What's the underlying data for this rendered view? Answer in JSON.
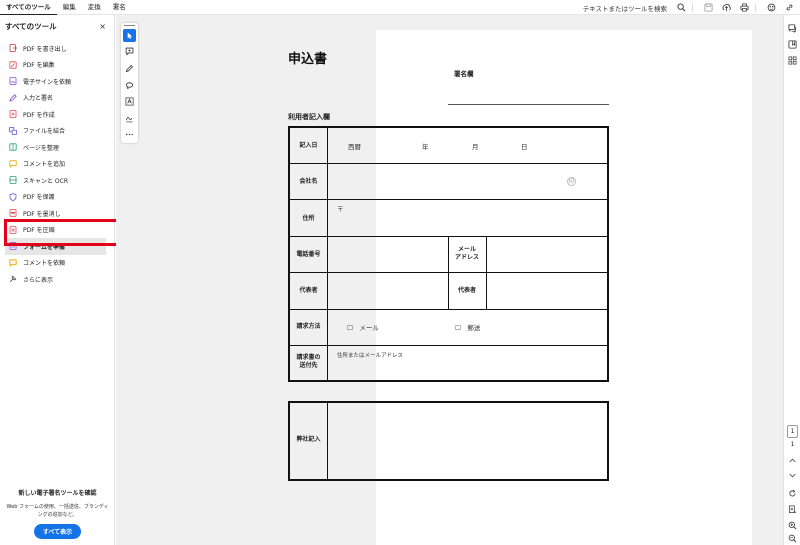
{
  "menu": {
    "items": [
      "すべてのツール",
      "編集",
      "変換",
      "署名"
    ]
  },
  "toolbar": {
    "search_text": "テキストまたはツールを検索",
    "icons": [
      "search-icon",
      "save-icon",
      "upload-icon",
      "print-icon",
      "share-icon",
      "link-icon"
    ]
  },
  "left_panel": {
    "title": "すべてのツール",
    "close": "×",
    "tools": [
      {
        "label": "PDF を書き出し",
        "icon": "export-pdf-icon",
        "color": "#d7373f"
      },
      {
        "label": "PDF を編集",
        "icon": "edit-pdf-icon",
        "color": "#e34850"
      },
      {
        "label": "電子サインを依頼",
        "icon": "request-esign-icon",
        "color": "#8d4bd6"
      },
      {
        "label": "入力と署名",
        "icon": "fill-sign-icon",
        "color": "#8d4bd6"
      },
      {
        "label": "PDF を作成",
        "icon": "create-pdf-icon",
        "color": "#e34850"
      },
      {
        "label": "ファイルを結合",
        "icon": "combine-files-icon",
        "color": "#5c5ce0"
      },
      {
        "label": "ページを整理",
        "icon": "organize-pages-icon",
        "color": "#2d9d78"
      },
      {
        "label": "コメントを追加",
        "icon": "comment-icon",
        "color": "#e6a700"
      },
      {
        "label": "スキャンと OCR",
        "icon": "scan-ocr-icon",
        "color": "#2d9d78"
      },
      {
        "label": "PDF を保護",
        "icon": "protect-pdf-icon",
        "color": "#5c5ce0"
      },
      {
        "label": "PDF を墨消し",
        "icon": "redact-pdf-icon",
        "color": "#e34850"
      },
      {
        "label": "PDF を圧縮",
        "icon": "compress-pdf-icon",
        "color": "#e34850"
      },
      {
        "label": "フォームを準備",
        "icon": "prepare-form-icon",
        "color": "#8d4bd6",
        "selected": true
      },
      {
        "label": "コメントを依頼",
        "icon": "request-comment-icon",
        "color": "#e6a700"
      },
      {
        "label": "さらに表示",
        "icon": "more-tools-icon",
        "color": "#444444"
      }
    ],
    "promo": {
      "title": "新しい電子署名ツールを確認",
      "description": "Web フォームの使用、一括送信、ブランディングの追加など。",
      "button": "すべて表示"
    }
  },
  "float_toolbar": {
    "tools": [
      "select-cursor-icon",
      "add-comment-icon",
      "draw-pen-icon",
      "draw-shape-icon",
      "add-text-icon",
      "sign-icon",
      "more-icon"
    ]
  },
  "document": {
    "title": "申込書",
    "sign_label": "署名欄",
    "section_title": "利用者記入欄",
    "rows": {
      "date_label": "記入日",
      "date_era": "西暦",
      "date_year": "年",
      "date_month": "月",
      "date_day": "日",
      "company_label": "会社名",
      "seal_mark": "印",
      "address_label": "住所",
      "postal_mark": "〒",
      "phone_label": "電話番号",
      "email_label_1": "メール",
      "email_label_2": "アドレス",
      "rep_label": "代表者",
      "rep_label_2": "代表者",
      "method_label": "請求方法",
      "method_mail": "☐　メール",
      "method_post": "☐　郵送",
      "dest_label_1": "請求書の",
      "dest_label_2": "送付先",
      "dest_value": "住所またはメールアドレス"
    },
    "office_label": "弊社記入"
  },
  "right_rail": {
    "current_page": "1",
    "total_pages": "1"
  },
  "colors": {
    "accent": "#1473e6",
    "highlight": "#e2001a"
  }
}
